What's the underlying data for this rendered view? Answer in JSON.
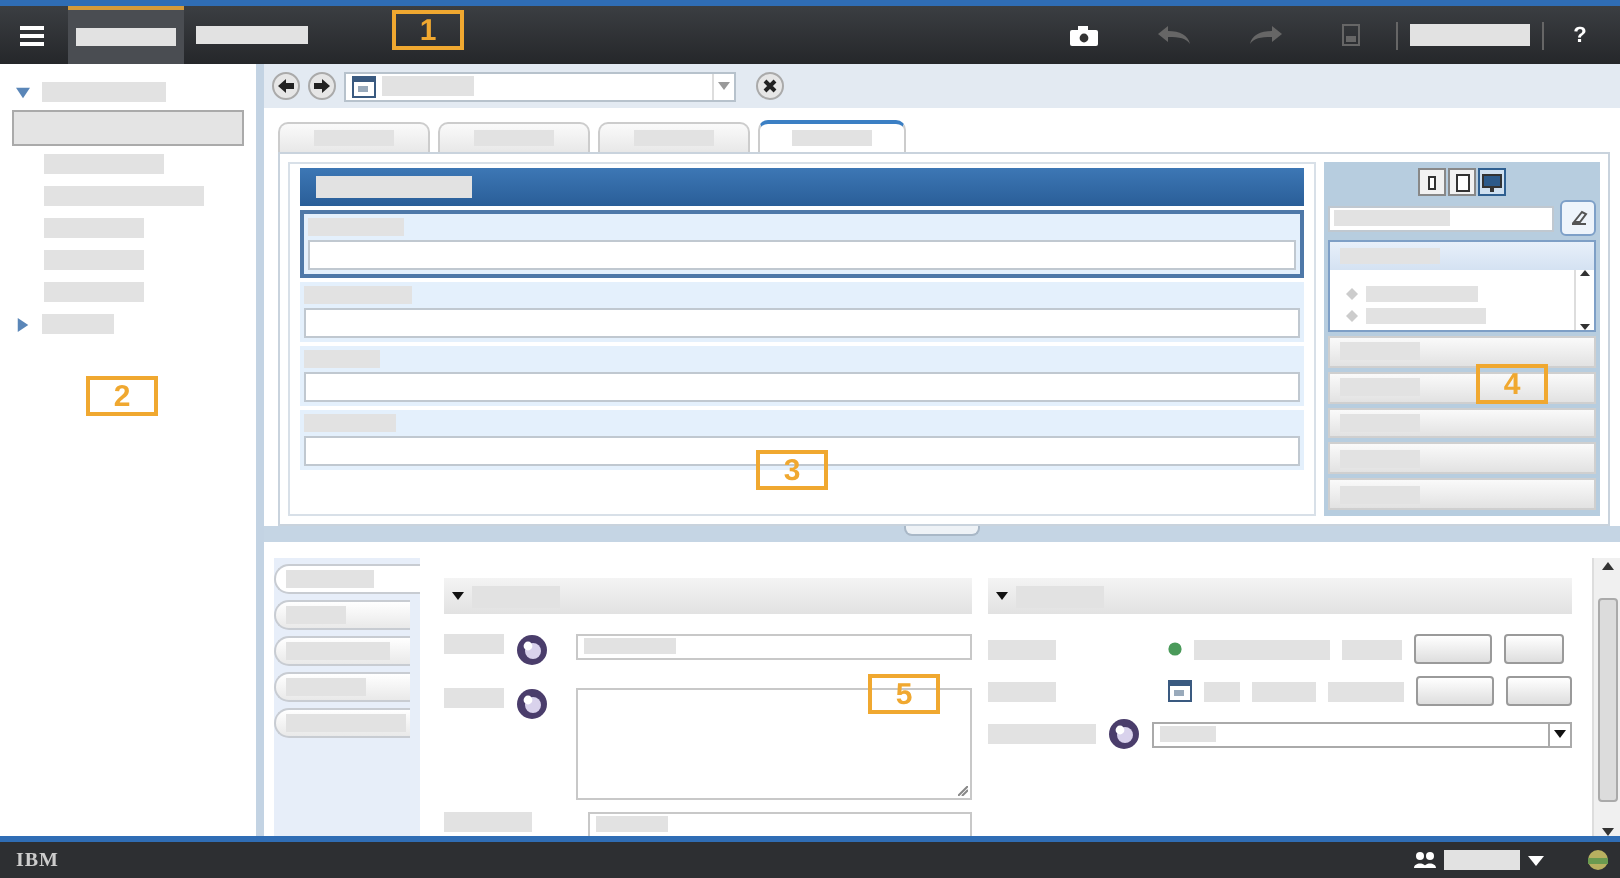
{
  "topbar": {
    "help": "?"
  },
  "callouts": [
    {
      "label": "1"
    },
    {
      "label": "2"
    },
    {
      "label": "3"
    },
    {
      "label": "4"
    },
    {
      "label": "5"
    }
  ],
  "tree": [
    {
      "expanded": true,
      "children": [
        {
          "selected": true
        },
        {
          "selected": false
        },
        {
          "selected": false
        },
        {
          "selected": false
        },
        {
          "selected": false
        },
        {
          "selected": false
        }
      ]
    },
    {
      "expanded": false
    }
  ],
  "workspace_tabs": [
    {
      "selected": false
    },
    {
      "selected": false
    },
    {
      "selected": false
    },
    {
      "selected": true
    }
  ],
  "view_toggle": [
    {
      "kind": "phone",
      "selected": false
    },
    {
      "kind": "tablet",
      "selected": false
    },
    {
      "kind": "desktop",
      "selected": true
    }
  ],
  "side_tabs": [
    {
      "selected": true
    },
    {
      "selected": false
    },
    {
      "selected": false
    },
    {
      "selected": false
    },
    {
      "selected": false
    }
  ],
  "sections": [
    {
      "expanded": true
    },
    {
      "expanded": true
    }
  ],
  "footer": {
    "logo": "IBM"
  }
}
